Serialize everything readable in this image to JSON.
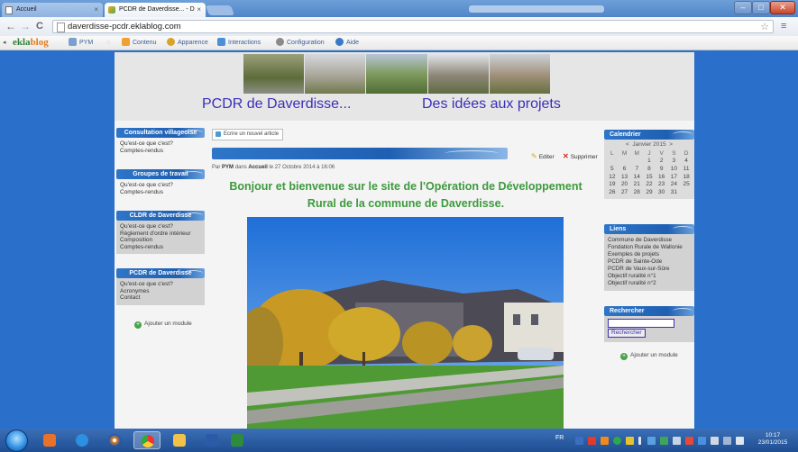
{
  "browser": {
    "tabs": [
      {
        "title": "Accueil",
        "active": false
      },
      {
        "title": "PCDR de Daverdisse... - D",
        "active": true
      }
    ],
    "address": "daverdisse-pcdr.eklablog.com",
    "window_controls": {
      "minimize": "–",
      "maximize": "□",
      "close": "✕"
    }
  },
  "eklablog_bar": {
    "logo_part1": "ekla",
    "logo_part2": "blog",
    "items": [
      "PYM",
      "Contenu",
      "Apparence",
      "Interactions",
      "Configuration",
      "Aide"
    ]
  },
  "site": {
    "title": "PCDR de Daverdisse...",
    "tagline": "Des idées aux projets"
  },
  "left_modules": [
    {
      "title": "Consultation villageoise",
      "links": [
        "Qu'est-ce que c'est?",
        "Comptes-rendus"
      ]
    },
    {
      "title": "Groupes de travail",
      "links": [
        "Qu'est-ce que c'est?",
        "Comptes-rendus"
      ]
    },
    {
      "title": "CLDR de Daverdisse",
      "links": [
        "Qu'est-ce que c'est?",
        "Règlement d'ordre intérieur",
        "Composition",
        "Comptes-rendus"
      ]
    },
    {
      "title": "PCDR de Daverdisse",
      "links": [
        "Qu'est-ce que c'est?",
        "Acronymes",
        "Contact"
      ]
    }
  ],
  "add_module_label": "Ajouter un module",
  "article": {
    "write_button": "Ecrire un nouvel article",
    "edit_label": "Editer",
    "delete_label": "Supprimer",
    "meta_prefix": "Par",
    "author": "PYM",
    "meta_in": "dans",
    "category": "Accueil",
    "meta_date": "le 27 Octobre 2014 à 16:06",
    "headline": "Bonjour et bienvenue sur le site de l'Opération de Développement Rural de la commune de Daverdisse."
  },
  "calendar": {
    "title": "Calendrier",
    "prev": "<",
    "next": ">",
    "month": "Janvier 2015",
    "weekdays": [
      "L",
      "M",
      "M",
      "J",
      "V",
      "S",
      "D"
    ],
    "weeks": [
      [
        "",
        "",
        "",
        "1",
        "2",
        "3",
        "4"
      ],
      [
        "5",
        "6",
        "7",
        "8",
        "9",
        "10",
        "11"
      ],
      [
        "12",
        "13",
        "14",
        "15",
        "16",
        "17",
        "18"
      ],
      [
        "19",
        "20",
        "21",
        "22",
        "23",
        "24",
        "25"
      ],
      [
        "26",
        "27",
        "28",
        "29",
        "30",
        "31",
        ""
      ]
    ]
  },
  "links_module": {
    "title": "Liens",
    "links": [
      "Commune de Daverdisse",
      "Fondation Rurale de Wallonie",
      "Exemples de projets",
      "PCDR de Sainte-Ode",
      "PCDR de Vaux-sur-Sûre",
      "Objectif ruralité n°1",
      "Objectif ruralité n°2"
    ]
  },
  "search_module": {
    "title": "Rechercher",
    "button": "Rechercher"
  },
  "taskbar": {
    "language": "FR",
    "time": "10:17",
    "date": "23/01/2015"
  },
  "colors": {
    "page_background": "#2a6fc9",
    "title_color": "#3a2fb8",
    "headline_color": "#3d9a3d",
    "module_header": "#1e5fb2"
  }
}
